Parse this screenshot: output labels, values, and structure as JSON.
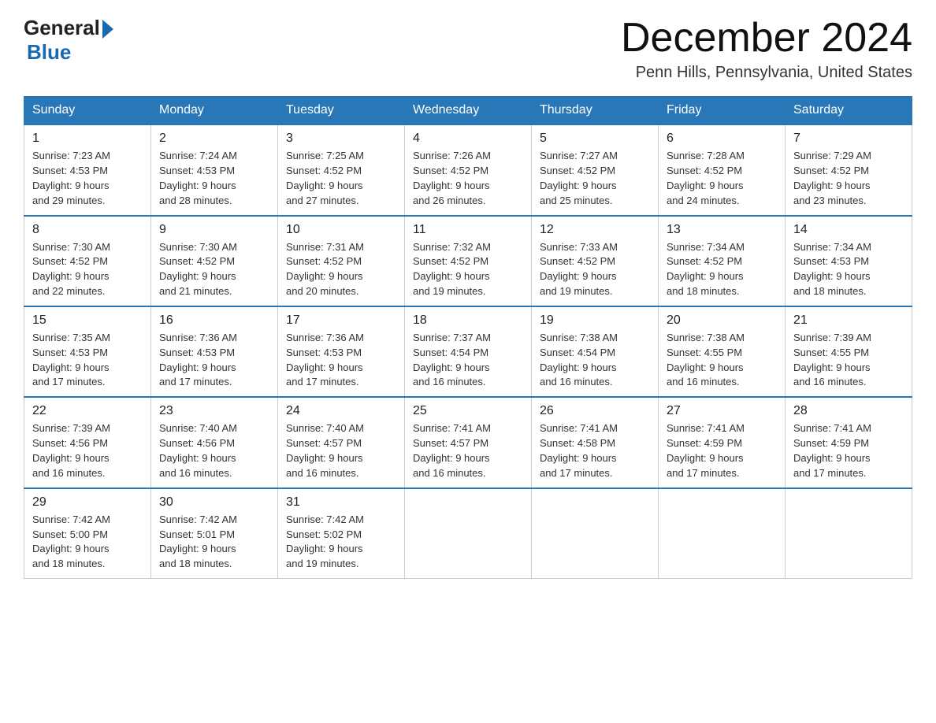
{
  "header": {
    "logo_general": "General",
    "logo_blue": "Blue",
    "month_year": "December 2024",
    "location": "Penn Hills, Pennsylvania, United States"
  },
  "days_of_week": [
    "Sunday",
    "Monday",
    "Tuesday",
    "Wednesday",
    "Thursday",
    "Friday",
    "Saturday"
  ],
  "weeks": [
    [
      {
        "num": "1",
        "sunrise": "7:23 AM",
        "sunset": "4:53 PM",
        "daylight": "9 hours and 29 minutes."
      },
      {
        "num": "2",
        "sunrise": "7:24 AM",
        "sunset": "4:53 PM",
        "daylight": "9 hours and 28 minutes."
      },
      {
        "num": "3",
        "sunrise": "7:25 AM",
        "sunset": "4:52 PM",
        "daylight": "9 hours and 27 minutes."
      },
      {
        "num": "4",
        "sunrise": "7:26 AM",
        "sunset": "4:52 PM",
        "daylight": "9 hours and 26 minutes."
      },
      {
        "num": "5",
        "sunrise": "7:27 AM",
        "sunset": "4:52 PM",
        "daylight": "9 hours and 25 minutes."
      },
      {
        "num": "6",
        "sunrise": "7:28 AM",
        "sunset": "4:52 PM",
        "daylight": "9 hours and 24 minutes."
      },
      {
        "num": "7",
        "sunrise": "7:29 AM",
        "sunset": "4:52 PM",
        "daylight": "9 hours and 23 minutes."
      }
    ],
    [
      {
        "num": "8",
        "sunrise": "7:30 AM",
        "sunset": "4:52 PM",
        "daylight": "9 hours and 22 minutes."
      },
      {
        "num": "9",
        "sunrise": "7:30 AM",
        "sunset": "4:52 PM",
        "daylight": "9 hours and 21 minutes."
      },
      {
        "num": "10",
        "sunrise": "7:31 AM",
        "sunset": "4:52 PM",
        "daylight": "9 hours and 20 minutes."
      },
      {
        "num": "11",
        "sunrise": "7:32 AM",
        "sunset": "4:52 PM",
        "daylight": "9 hours and 19 minutes."
      },
      {
        "num": "12",
        "sunrise": "7:33 AM",
        "sunset": "4:52 PM",
        "daylight": "9 hours and 19 minutes."
      },
      {
        "num": "13",
        "sunrise": "7:34 AM",
        "sunset": "4:52 PM",
        "daylight": "9 hours and 18 minutes."
      },
      {
        "num": "14",
        "sunrise": "7:34 AM",
        "sunset": "4:53 PM",
        "daylight": "9 hours and 18 minutes."
      }
    ],
    [
      {
        "num": "15",
        "sunrise": "7:35 AM",
        "sunset": "4:53 PM",
        "daylight": "9 hours and 17 minutes."
      },
      {
        "num": "16",
        "sunrise": "7:36 AM",
        "sunset": "4:53 PM",
        "daylight": "9 hours and 17 minutes."
      },
      {
        "num": "17",
        "sunrise": "7:36 AM",
        "sunset": "4:53 PM",
        "daylight": "9 hours and 17 minutes."
      },
      {
        "num": "18",
        "sunrise": "7:37 AM",
        "sunset": "4:54 PM",
        "daylight": "9 hours and 16 minutes."
      },
      {
        "num": "19",
        "sunrise": "7:38 AM",
        "sunset": "4:54 PM",
        "daylight": "9 hours and 16 minutes."
      },
      {
        "num": "20",
        "sunrise": "7:38 AM",
        "sunset": "4:55 PM",
        "daylight": "9 hours and 16 minutes."
      },
      {
        "num": "21",
        "sunrise": "7:39 AM",
        "sunset": "4:55 PM",
        "daylight": "9 hours and 16 minutes."
      }
    ],
    [
      {
        "num": "22",
        "sunrise": "7:39 AM",
        "sunset": "4:56 PM",
        "daylight": "9 hours and 16 minutes."
      },
      {
        "num": "23",
        "sunrise": "7:40 AM",
        "sunset": "4:56 PM",
        "daylight": "9 hours and 16 minutes."
      },
      {
        "num": "24",
        "sunrise": "7:40 AM",
        "sunset": "4:57 PM",
        "daylight": "9 hours and 16 minutes."
      },
      {
        "num": "25",
        "sunrise": "7:41 AM",
        "sunset": "4:57 PM",
        "daylight": "9 hours and 16 minutes."
      },
      {
        "num": "26",
        "sunrise": "7:41 AM",
        "sunset": "4:58 PM",
        "daylight": "9 hours and 17 minutes."
      },
      {
        "num": "27",
        "sunrise": "7:41 AM",
        "sunset": "4:59 PM",
        "daylight": "9 hours and 17 minutes."
      },
      {
        "num": "28",
        "sunrise": "7:41 AM",
        "sunset": "4:59 PM",
        "daylight": "9 hours and 17 minutes."
      }
    ],
    [
      {
        "num": "29",
        "sunrise": "7:42 AM",
        "sunset": "5:00 PM",
        "daylight": "9 hours and 18 minutes."
      },
      {
        "num": "30",
        "sunrise": "7:42 AM",
        "sunset": "5:01 PM",
        "daylight": "9 hours and 18 minutes."
      },
      {
        "num": "31",
        "sunrise": "7:42 AM",
        "sunset": "5:02 PM",
        "daylight": "9 hours and 19 minutes."
      },
      null,
      null,
      null,
      null
    ]
  ],
  "labels": {
    "sunrise": "Sunrise:",
    "sunset": "Sunset:",
    "daylight": "Daylight:"
  }
}
